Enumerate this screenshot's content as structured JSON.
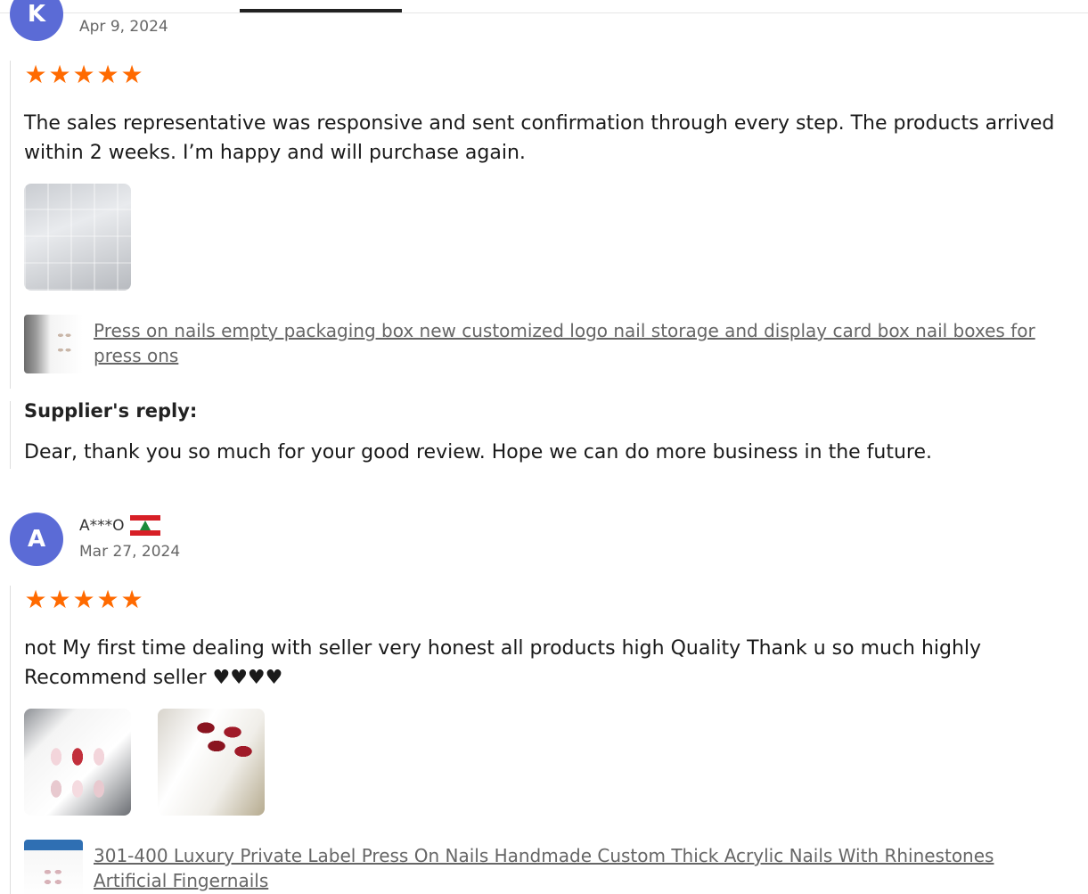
{
  "reviews": [
    {
      "avatar_letter": "K",
      "name": "",
      "date": "Apr 9, 2024",
      "rating": 5,
      "text": "The sales representative was responsive and sent confirmation through every step. The products arrived within 2 weeks. I’m happy and will purchase again.",
      "photos": [
        "packaging-box-photo"
      ],
      "product_link": "Press on nails empty packaging box new customized logo nail storage and display card box nail boxes for press ons",
      "supplier_reply_title": "Supplier's reply:",
      "supplier_reply": "Dear, thank you so much for your good review. Hope we can do more business in the future."
    },
    {
      "avatar_letter": "A",
      "name": "A***O",
      "country_flag": "lebanon-flag-icon",
      "date": "Mar 27, 2024",
      "rating": 5,
      "text": "not My first time dealing with seller very honest all products high Quality Thank u so much highly Recommend seller ♥♥♥♥",
      "photos": [
        "press-on-nails-photo-1",
        "press-on-nails-photo-2"
      ],
      "product_link": "301-400 Luxury Private Label Press On Nails Handmade Custom Thick Acrylic Nails With Rhinestones Artificial Fingernails"
    }
  ],
  "colors": {
    "star": "#ff6a00",
    "avatar": "#5b6bd6",
    "link": "#666666"
  }
}
